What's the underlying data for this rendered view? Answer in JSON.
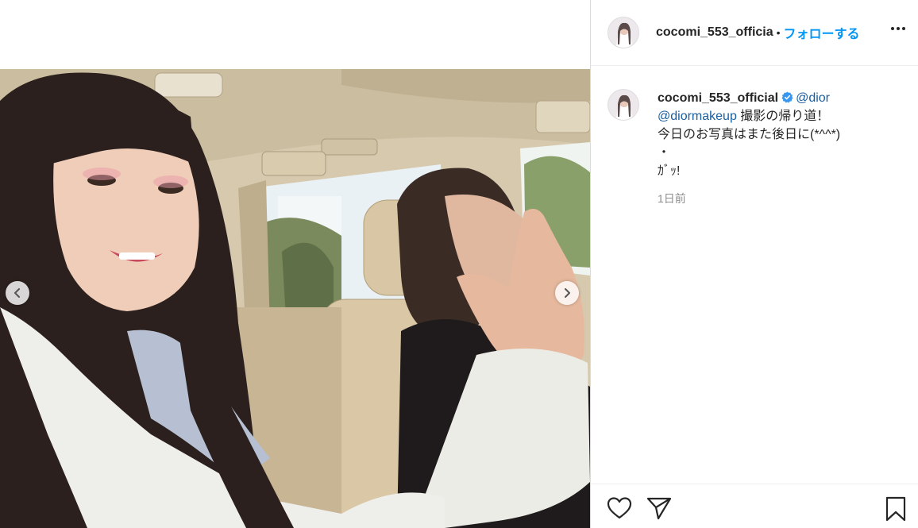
{
  "post": {
    "username": "cocomi_553_officia",
    "separator": "•",
    "follow_label": "フォローする"
  },
  "caption": {
    "username": "cocomi_553_official",
    "mention1": "@dior",
    "mention2": "@diormakeup",
    "line1_rest": "撮影の帰り道！",
    "line2": "今日のお写真はまた後日に(*^^*)",
    "line3": "・",
    "line4": "ｶﾞｯ!",
    "time": "1日前"
  },
  "icons": {
    "more": "more-options-icon",
    "verified": "verified-badge-icon",
    "prev": "chevron-left-icon",
    "next": "chevron-right-icon",
    "like": "heart-icon",
    "share": "paper-plane-icon",
    "save": "bookmark-icon"
  },
  "colors": {
    "accent": "#0095f6",
    "verified": "#3897f0",
    "muted": "#8e8e8e"
  }
}
